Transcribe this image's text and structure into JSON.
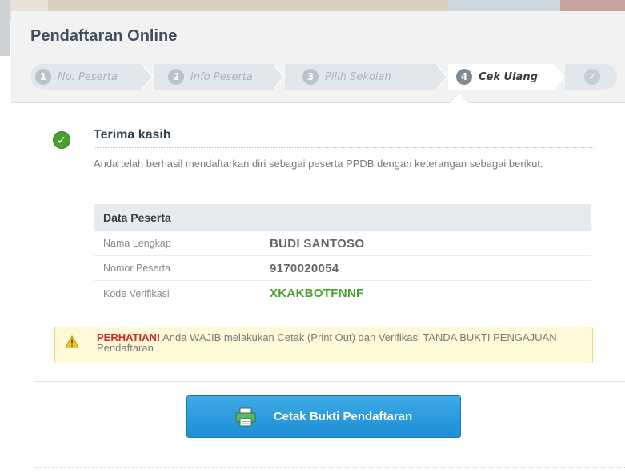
{
  "modal": {
    "title": "Pendaftaran Online"
  },
  "wizard": {
    "steps": [
      {
        "number": "1",
        "label": "No. Peserta"
      },
      {
        "number": "2",
        "label": "Info Peserta"
      },
      {
        "number": "3",
        "label": "Pilih Sekolah"
      },
      {
        "number": "4",
        "label": "Cek Ulang"
      }
    ],
    "active_step": 4,
    "final_icon": "check-icon"
  },
  "confirmation": {
    "icon": "check-circle-icon",
    "title": "Terima kasih",
    "description": "Anda telah berhasil mendaftarkan diri sebagai peserta PPDB dengan keterangan sebagai berikut:"
  },
  "participant_table": {
    "header": "Data Peserta",
    "rows": [
      {
        "label": "Nama Lengkap",
        "value": "BUDI SANTOSO"
      },
      {
        "label": "Nomor Peserta",
        "value": "9170020054"
      },
      {
        "label": "Kode Verifikasi",
        "value": "XKAKBOTFNNF"
      }
    ]
  },
  "alert": {
    "icon": "warning-icon",
    "strong": "PERHATIAN!",
    "text": " Anda WAJIB melakukan Cetak (Print Out) dan Verifikasi TANDA BUKTI PENGAJUAN Pendaftaran"
  },
  "print_button": {
    "icon": "printer-icon",
    "label": "Cetak Bukti Pendaftaran"
  },
  "colors": {
    "accent_blue": "#1d8fd4",
    "success_green": "#4aa02c",
    "warning_red": "#c62828",
    "alert_bg": "#fff9d8"
  }
}
